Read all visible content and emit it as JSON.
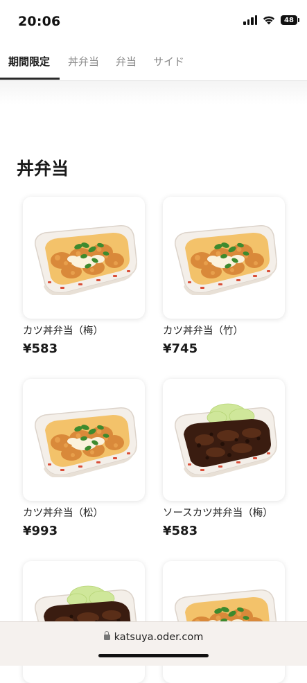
{
  "status_bar": {
    "time": "20:06",
    "battery": "48",
    "icons": [
      "signal-icon",
      "wifi-icon",
      "battery-icon"
    ]
  },
  "tabs": [
    {
      "label": "期間限定",
      "active": true
    },
    {
      "label": "丼弁当",
      "active": false
    },
    {
      "label": "弁当",
      "active": false
    },
    {
      "label": "サイド",
      "active": false
    }
  ],
  "section": {
    "title": "丼弁当"
  },
  "products": [
    {
      "name": "カツ丼弁当（梅）",
      "price": "¥583",
      "image": "katsudon-bento-image"
    },
    {
      "name": "カツ丼弁当（竹）",
      "price": "¥745",
      "image": "katsudon-bento-image"
    },
    {
      "name": "カツ丼弁当（松）",
      "price": "¥993",
      "image": "katsudon-bento-image"
    },
    {
      "name": "ソースカツ丼弁当（梅）",
      "price": "¥583",
      "image": "sauce-katsudon-bento-image"
    },
    {
      "name": "",
      "price": "",
      "image": "sauce-katsudon-bento-image"
    },
    {
      "name": "",
      "price": "",
      "image": "katsudon-bento-image"
    }
  ],
  "browser": {
    "url": "katsuya.oder.com"
  },
  "colors": {
    "accent_text": "#1a1a1a",
    "inactive_tab": "#8a8a8a",
    "url_bar_bg": "#f5f1ee"
  }
}
